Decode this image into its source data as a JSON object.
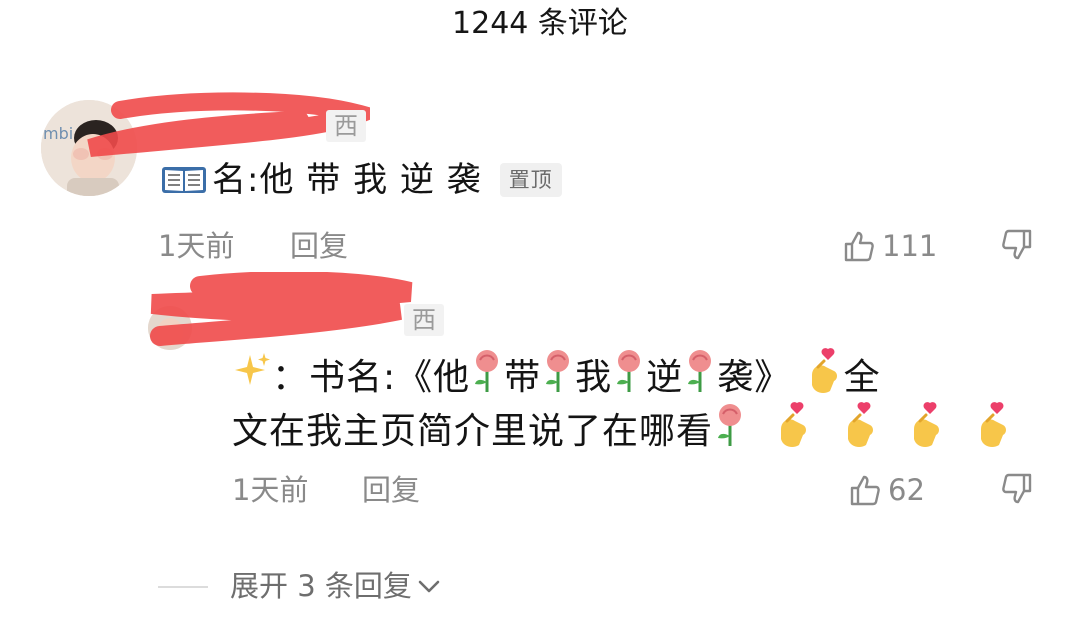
{
  "header": {
    "comment_count_title": "1244 条评论"
  },
  "comment": {
    "user_tail": "西",
    "avatar_watermark": "mbi",
    "book_icon": "open-book-icon",
    "text": "名:他 带 我 逆 袭",
    "pin_label": "置顶",
    "time": "1天前",
    "reply_label": "回复",
    "like_count": "111"
  },
  "reply": {
    "user_tail": "西",
    "line1_prefix": "：书名:《他",
    "line1_parts": [
      "带",
      "我",
      "逆",
      "袭》"
    ],
    "line1_suffix": "全",
    "line2_text": "文在我主页简介里说了在哪看",
    "time": "1天前",
    "reply_label": "回复",
    "like_count": "62"
  },
  "expand": {
    "label": "展开 3 条回复"
  },
  "colors": {
    "redact": "#f04a4a",
    "text_muted": "#8a8a8a",
    "rose": "#e8757a"
  }
}
